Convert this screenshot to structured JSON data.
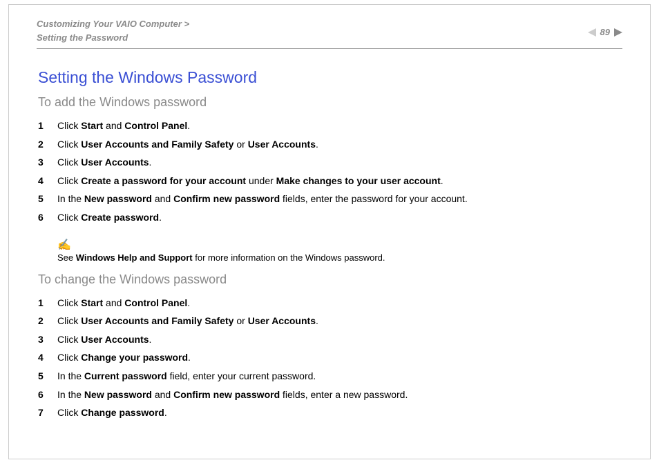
{
  "header": {
    "breadcrumb_line1": "Customizing Your VAIO Computer >",
    "breadcrumb_line2": "Setting the Password",
    "page_number": "89"
  },
  "title": "Setting the Windows Password",
  "section1": {
    "heading": "To add the Windows password",
    "steps": [
      {
        "num": "1",
        "html": "Click <b>Start</b> and <b>Control Panel</b>."
      },
      {
        "num": "2",
        "html": "Click <b>User Accounts and Family Safety</b> or <b>User Accounts</b>."
      },
      {
        "num": "3",
        "html": "Click <b>User Accounts</b>."
      },
      {
        "num": "4",
        "html": "Click <b>Create a password for your account</b> under <b>Make changes to your user account</b>."
      },
      {
        "num": "5",
        "html": "In the <b>New password</b> and <b>Confirm new password</b> fields, enter the password for your account."
      },
      {
        "num": "6",
        "html": "Click <b>Create password</b>."
      }
    ],
    "note_icon": "✍",
    "note_html": "See <b>Windows Help and Support</b> for more information on the Windows password."
  },
  "section2": {
    "heading": "To change the Windows password",
    "steps": [
      {
        "num": "1",
        "html": "Click <b>Start</b> and <b>Control Panel</b>."
      },
      {
        "num": "2",
        "html": "Click <b>User Accounts and Family Safety</b> or <b>User Accounts</b>."
      },
      {
        "num": "3",
        "html": "Click <b>User Accounts</b>."
      },
      {
        "num": "4",
        "html": "Click <b>Change your password</b>."
      },
      {
        "num": "5",
        "html": "In the <b>Current password</b> field, enter your current password."
      },
      {
        "num": "6",
        "html": "In the <b>New password</b> and <b>Confirm new password</b> fields, enter a new password."
      },
      {
        "num": "7",
        "html": "Click <b>Change password</b>."
      }
    ]
  }
}
